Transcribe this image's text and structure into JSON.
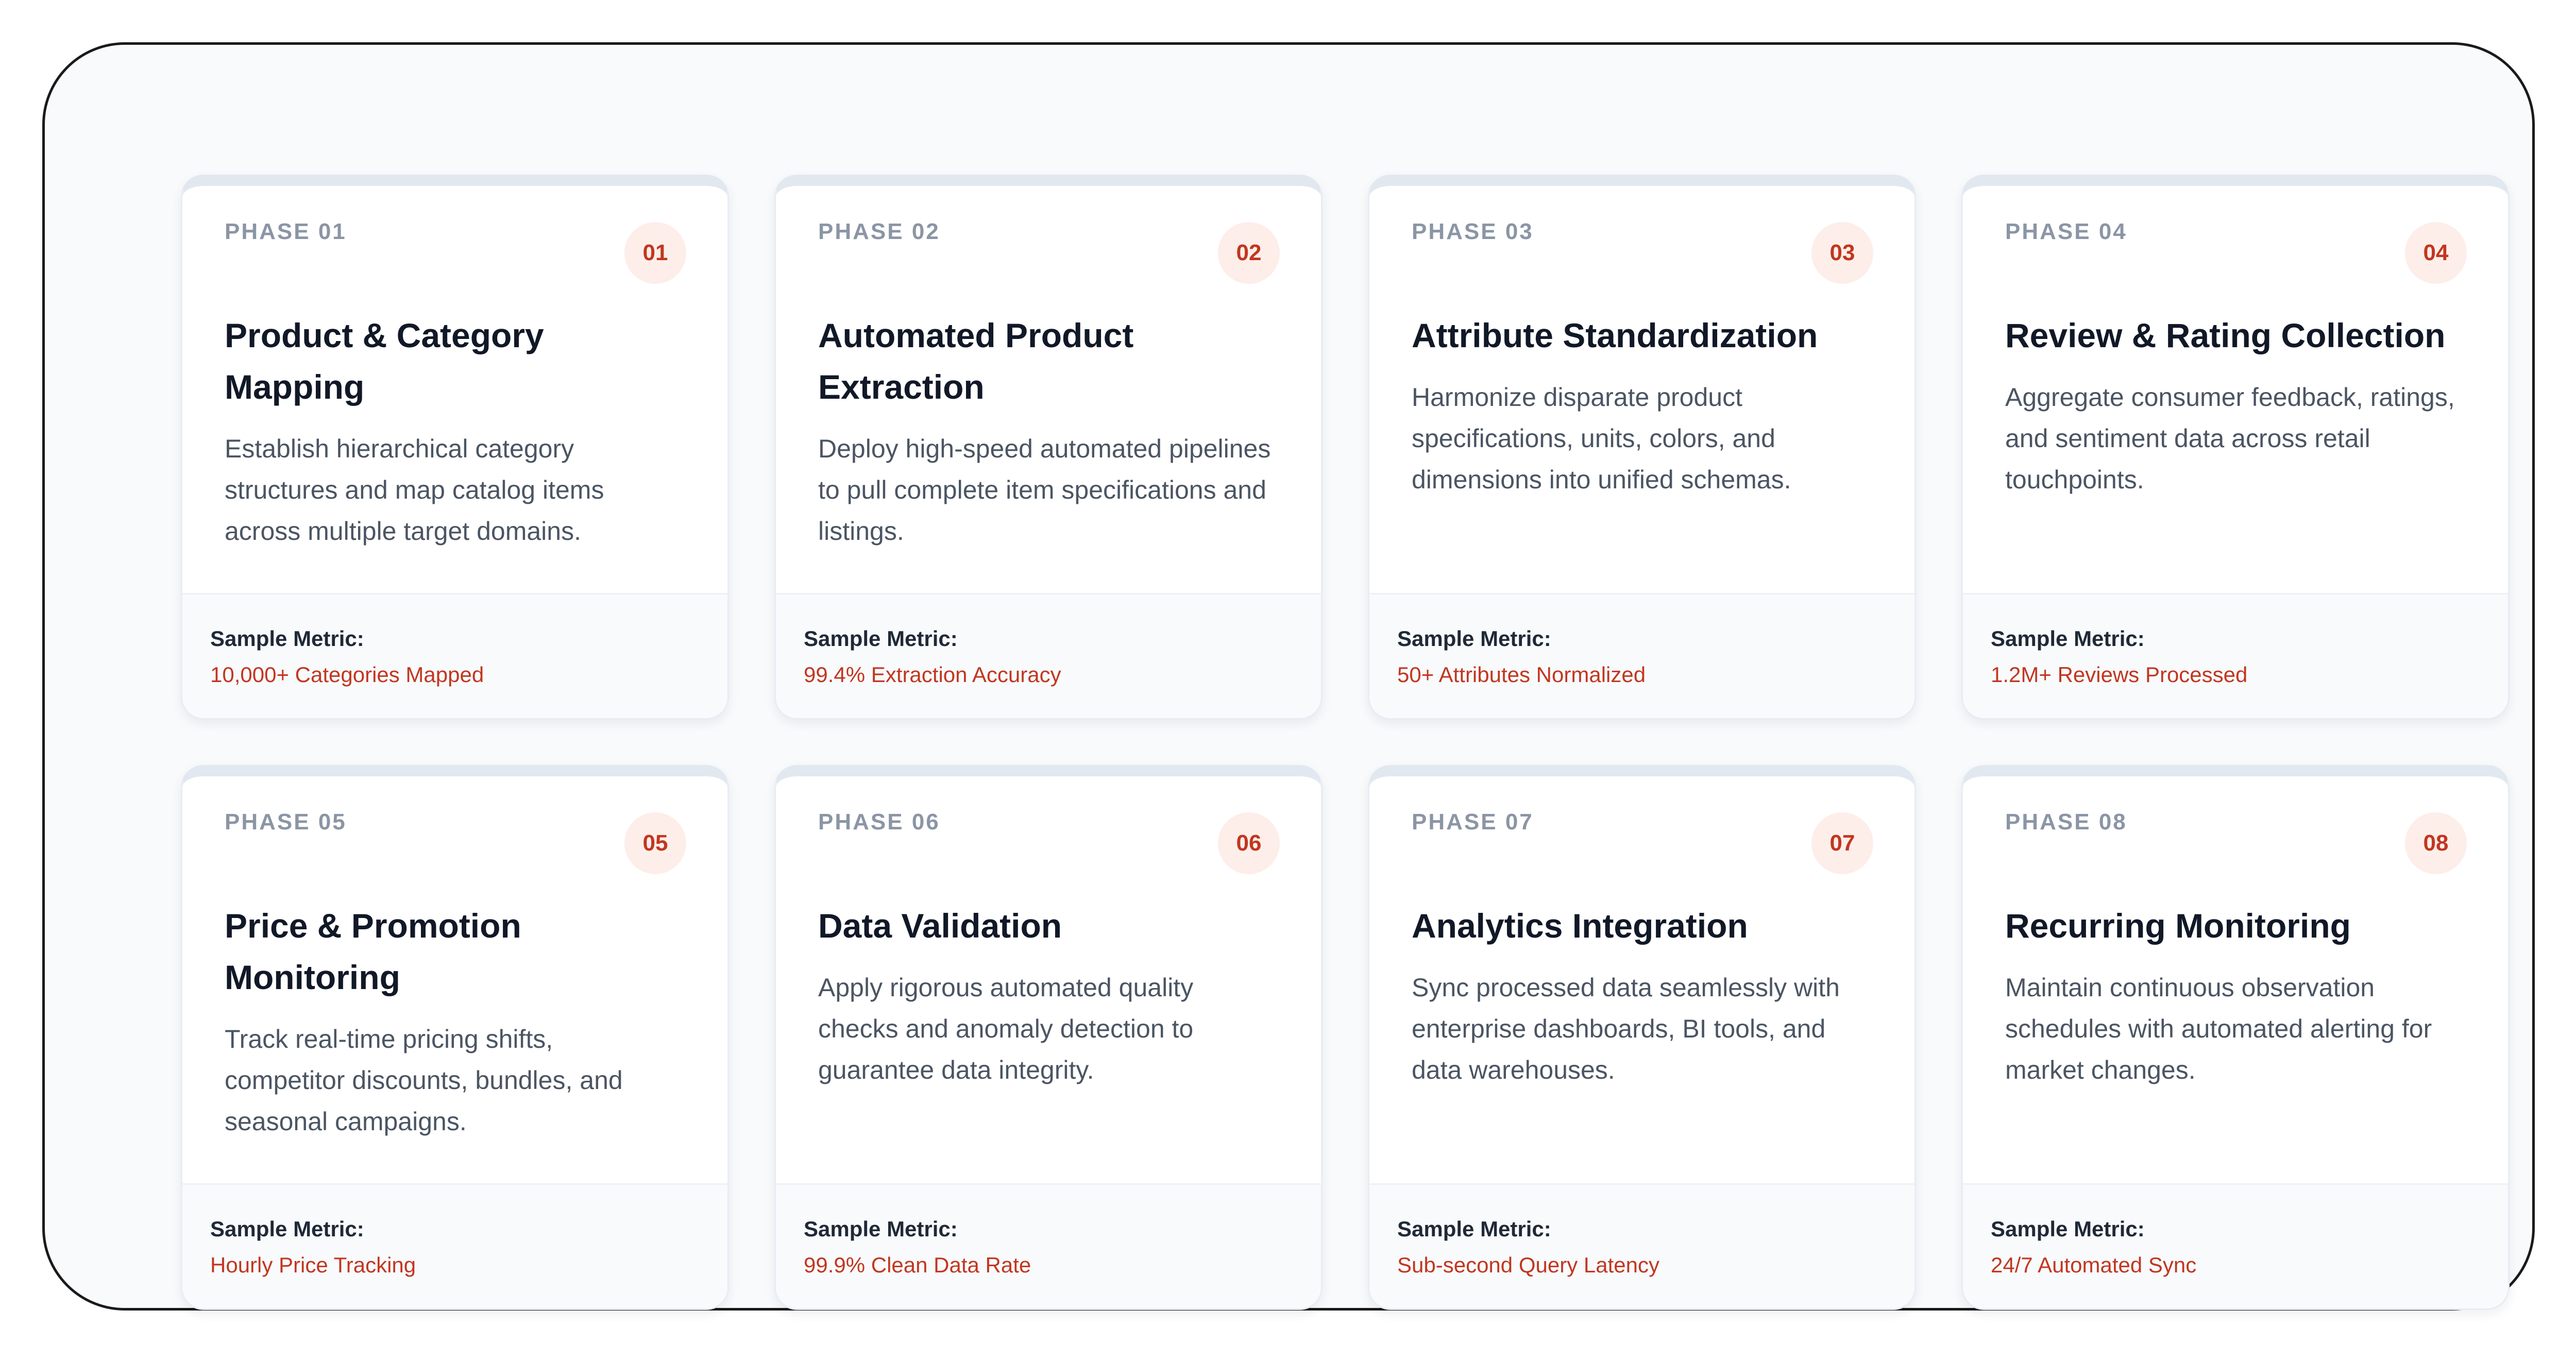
{
  "colors": {
    "accent": "#c2361f",
    "badge_bg": "#fdeeea",
    "title": "#111827",
    "body_text": "#4b5563",
    "phase_label": "#8b95a5",
    "card_top_bar": "#e2e8f0",
    "footer_bg": "#f8fafc"
  },
  "metric_label": "Sample Metric:",
  "cards": [
    {
      "phase": "PHASE 01",
      "number": "01",
      "title": "Product & Category Mapping",
      "description": "Establish hierarchical category structures and map catalog items across multiple target domains.",
      "metric": "10,000+ Categories Mapped"
    },
    {
      "phase": "PHASE 02",
      "number": "02",
      "title": "Automated Product Extraction",
      "description": "Deploy high-speed automated pipelines to pull complete item specifications and listings.",
      "metric": "99.4% Extraction Accuracy"
    },
    {
      "phase": "PHASE 03",
      "number": "03",
      "title": "Attribute Standardization",
      "description": "Harmonize disparate product specifications, units, colors, and dimensions into unified schemas.",
      "metric": "50+ Attributes Normalized"
    },
    {
      "phase": "PHASE 04",
      "number": "04",
      "title": "Review & Rating Collection",
      "description": "Aggregate consumer feedback, ratings, and sentiment data across retail touchpoints.",
      "metric": "1.2M+ Reviews Processed"
    },
    {
      "phase": "PHASE 05",
      "number": "05",
      "title": "Price & Promotion Monitoring",
      "description": "Track real-time pricing shifts, competitor discounts, bundles, and seasonal campaigns.",
      "metric": "Hourly Price Tracking"
    },
    {
      "phase": "PHASE 06",
      "number": "06",
      "title": "Data Validation",
      "description": "Apply rigorous automated quality checks and anomaly detection to guarantee data integrity.",
      "metric": "99.9% Clean Data Rate"
    },
    {
      "phase": "PHASE 07",
      "number": "07",
      "title": "Analytics Integration",
      "description": "Sync processed data seamlessly with enterprise dashboards, BI tools, and data warehouses.",
      "metric": "Sub-second Query Latency"
    },
    {
      "phase": "PHASE 08",
      "number": "08",
      "title": "Recurring Monitoring",
      "description": "Maintain continuous observation schedules with automated alerting for market changes.",
      "metric": "24/7 Automated Sync"
    }
  ]
}
